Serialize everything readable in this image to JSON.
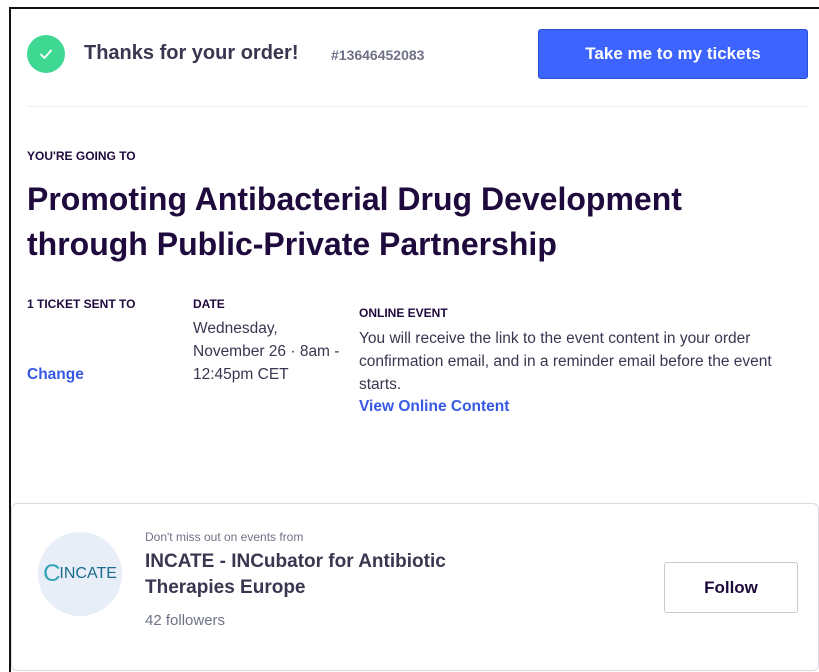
{
  "header": {
    "thanks_text": "Thanks for your order!",
    "order_number": "#13646452083",
    "tickets_button": "Take me to my tickets",
    "check_icon": "check-icon",
    "check_color": "#3fd893",
    "button_color": "#3d64ff"
  },
  "event": {
    "going_to_label": "YOU'RE GOING TO",
    "title": "Promoting Antibacterial Drug Development through Public-Private Partnership"
  },
  "details": {
    "ticket_sent_label": "1 TICKET SENT TO",
    "change_link": "Change",
    "date_label": "DATE",
    "date_text": "Wednesday, November 26 · 8am - 12:45pm CET",
    "online_label": "ONLINE EVENT",
    "online_text": "You will receive the link to the event content in your order confirmation email, and in a reminder email before the event starts.",
    "view_link": "View Online Content"
  },
  "organizer": {
    "dont_miss_text": "Don't miss out on events from",
    "name": "INCATE - INCubator for Antibiotic Therapies Europe",
    "followers": "42 followers",
    "follow_button": "Follow",
    "logo_text_c": "C",
    "logo_text_rest": "INCATE"
  }
}
